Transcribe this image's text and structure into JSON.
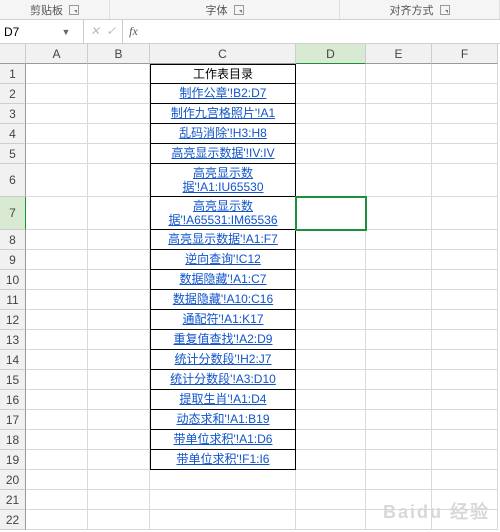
{
  "ribbon": {
    "clipboard": "剪贴板",
    "font": "字体",
    "alignment": "对齐方式"
  },
  "namebox": {
    "value": "D7"
  },
  "fx": {
    "cancel": "✕",
    "confirm": "✓",
    "label": "fx"
  },
  "formula": {
    "value": ""
  },
  "columns": [
    "A",
    "B",
    "C",
    "D",
    "E",
    "F"
  ],
  "rows": [
    "1",
    "2",
    "3",
    "4",
    "5",
    "6",
    "7",
    "8",
    "9",
    "10",
    "11",
    "12",
    "13",
    "14",
    "15",
    "16",
    "17",
    "18",
    "19",
    "20",
    "21",
    "22"
  ],
  "table": {
    "header": "工作表目录",
    "links": [
      "制作公章'!B2:D7",
      "制作九宫格照片'!A1",
      "乱码消除'!H3:H8",
      "高亮显示数据'!IV:IV",
      "高亮显示数据'!A1:IU65530",
      "高亮显示数据'!A65531:IM65536",
      "高亮显示数据'!A1:F7",
      "逆向查询'!C12",
      "数据隐藏'!A1:C7",
      "数据隐藏'!A10:C16",
      "通配符'!A1:K17",
      "重复值查找'!A2:D9",
      "统计分数段'!H2:J7",
      "统计分数段'!A3:D10",
      "提取生肖'!A1:D4",
      "动态求和'!A1:B19",
      "带单位求积'!A1:D6",
      "带单位求积'!F1:I6"
    ]
  },
  "watermark": "Baidu 经验"
}
